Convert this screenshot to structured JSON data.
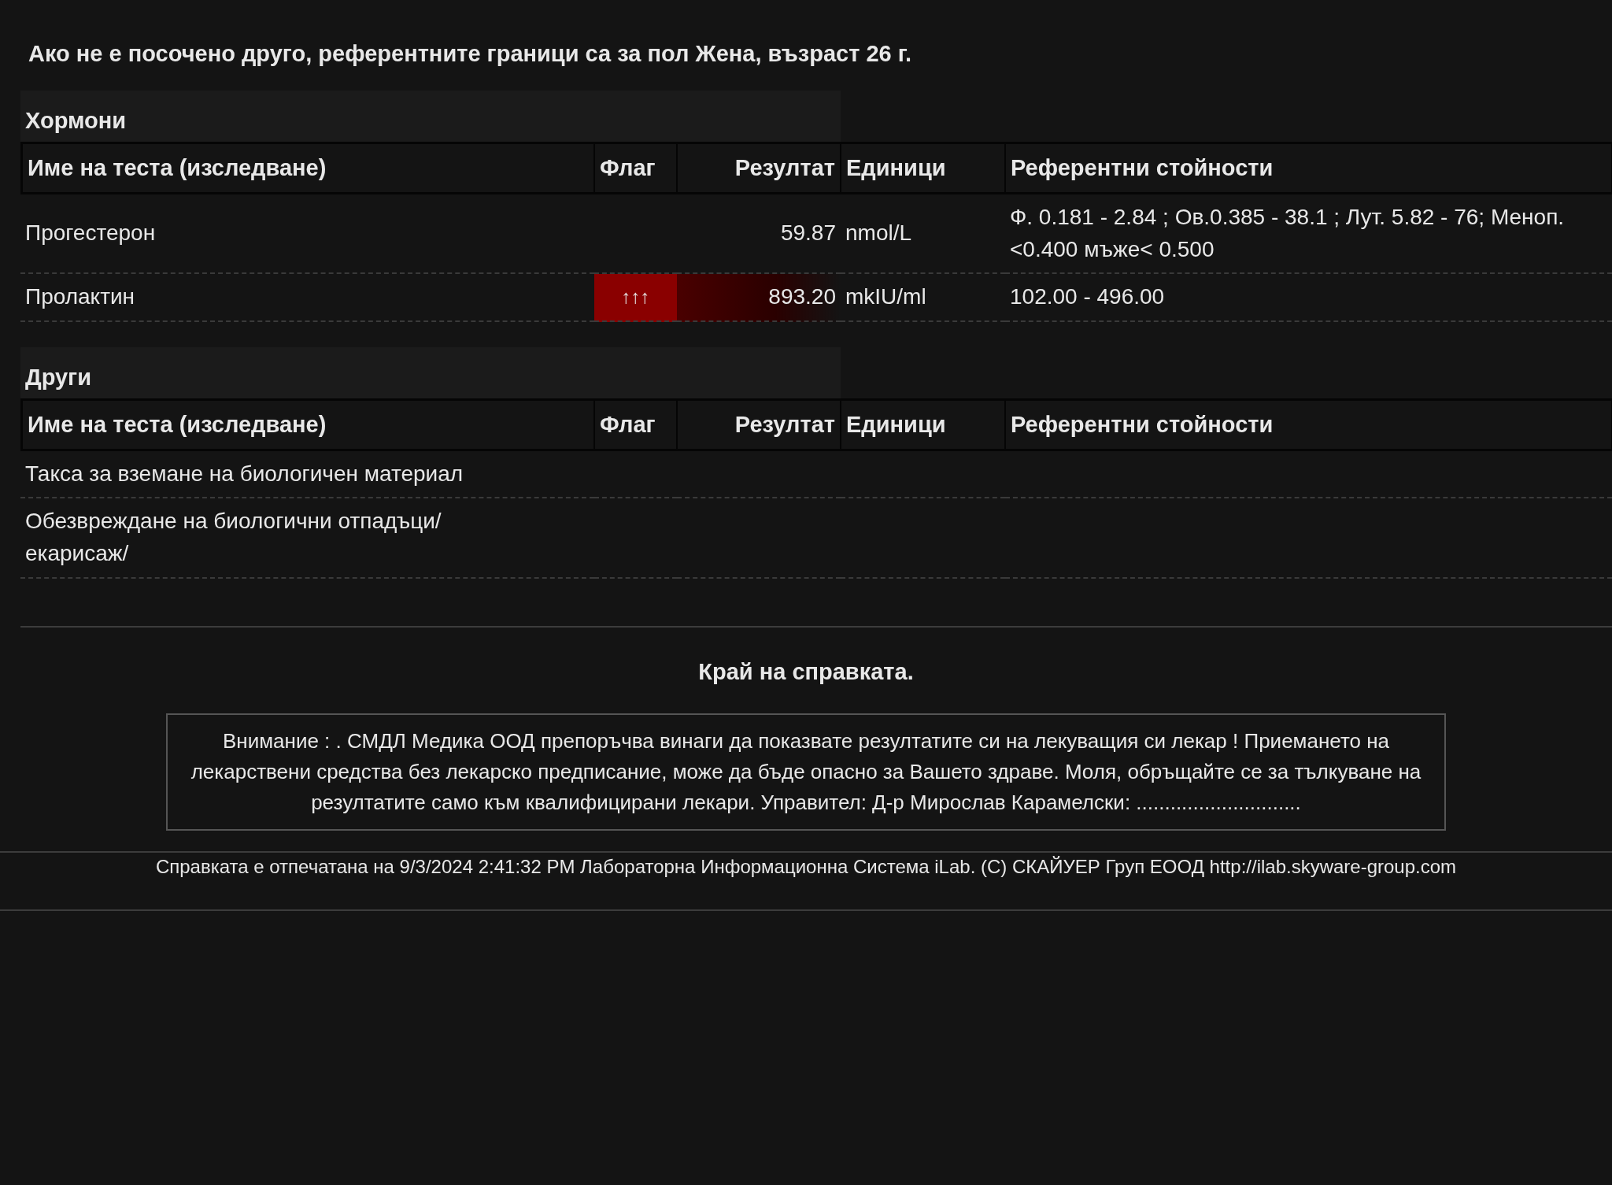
{
  "intro": "Ако не е посочено друго, референтните граници са за пол Жена, възраст 26 г.",
  "sections": [
    {
      "title": "Хормони",
      "columns": [
        "Име на теста (изследване)",
        "Флаг",
        "Резултат",
        "Единици",
        "Референтни стойности"
      ],
      "rows": [
        {
          "name": "Прогестерон",
          "abnormal": false,
          "result": "59.87",
          "units": "nmol/L",
          "reference": "Ф. 0.181 - 2.84 ; Ов.0.385 - 38.1 ; Лут. 5.82 - 76; Меноп. <0.400 мъже< 0.500"
        },
        {
          "name": "Пролактин",
          "flag": "↑↑↑",
          "abnormal": true,
          "result": "893.20",
          "units": "mkIU/ml",
          "reference": "102.00 - 496.00"
        }
      ]
    },
    {
      "title": "Други",
      "columns": [
        "Име на теста (изследване)",
        "Флаг",
        "Резултат",
        "Единици",
        "Референтни стойности"
      ],
      "rows": [
        {
          "name": "Такса за вземане на биологичен материал",
          "abnormal": false
        },
        {
          "name": "Обезвреждане на биологични отпадъци/ екарисаж/",
          "abnormal": false
        }
      ]
    }
  ],
  "end_note": "Край на справката.",
  "notice": "Внимание : . СМДЛ Медика ООД препоръчва винаги да показвате резултатите си на лекуващия си лекар ! Приемането на лекарствени средства без лекарско предписание, може да бъде опасно за Вашето здраве. Моля, обръщайте се за тълкуване на резултатите само към квалифицирани лекари. Управител: Д-р Мирослав Карамелски: .............................",
  "footer": "Справката е отпечатана на 9/3/2024 2:41:32 PM Лабораторна Информационна Система iLab. (C) СКАЙУЕР Груп ЕООД http://ilab.skyware-group.com"
}
